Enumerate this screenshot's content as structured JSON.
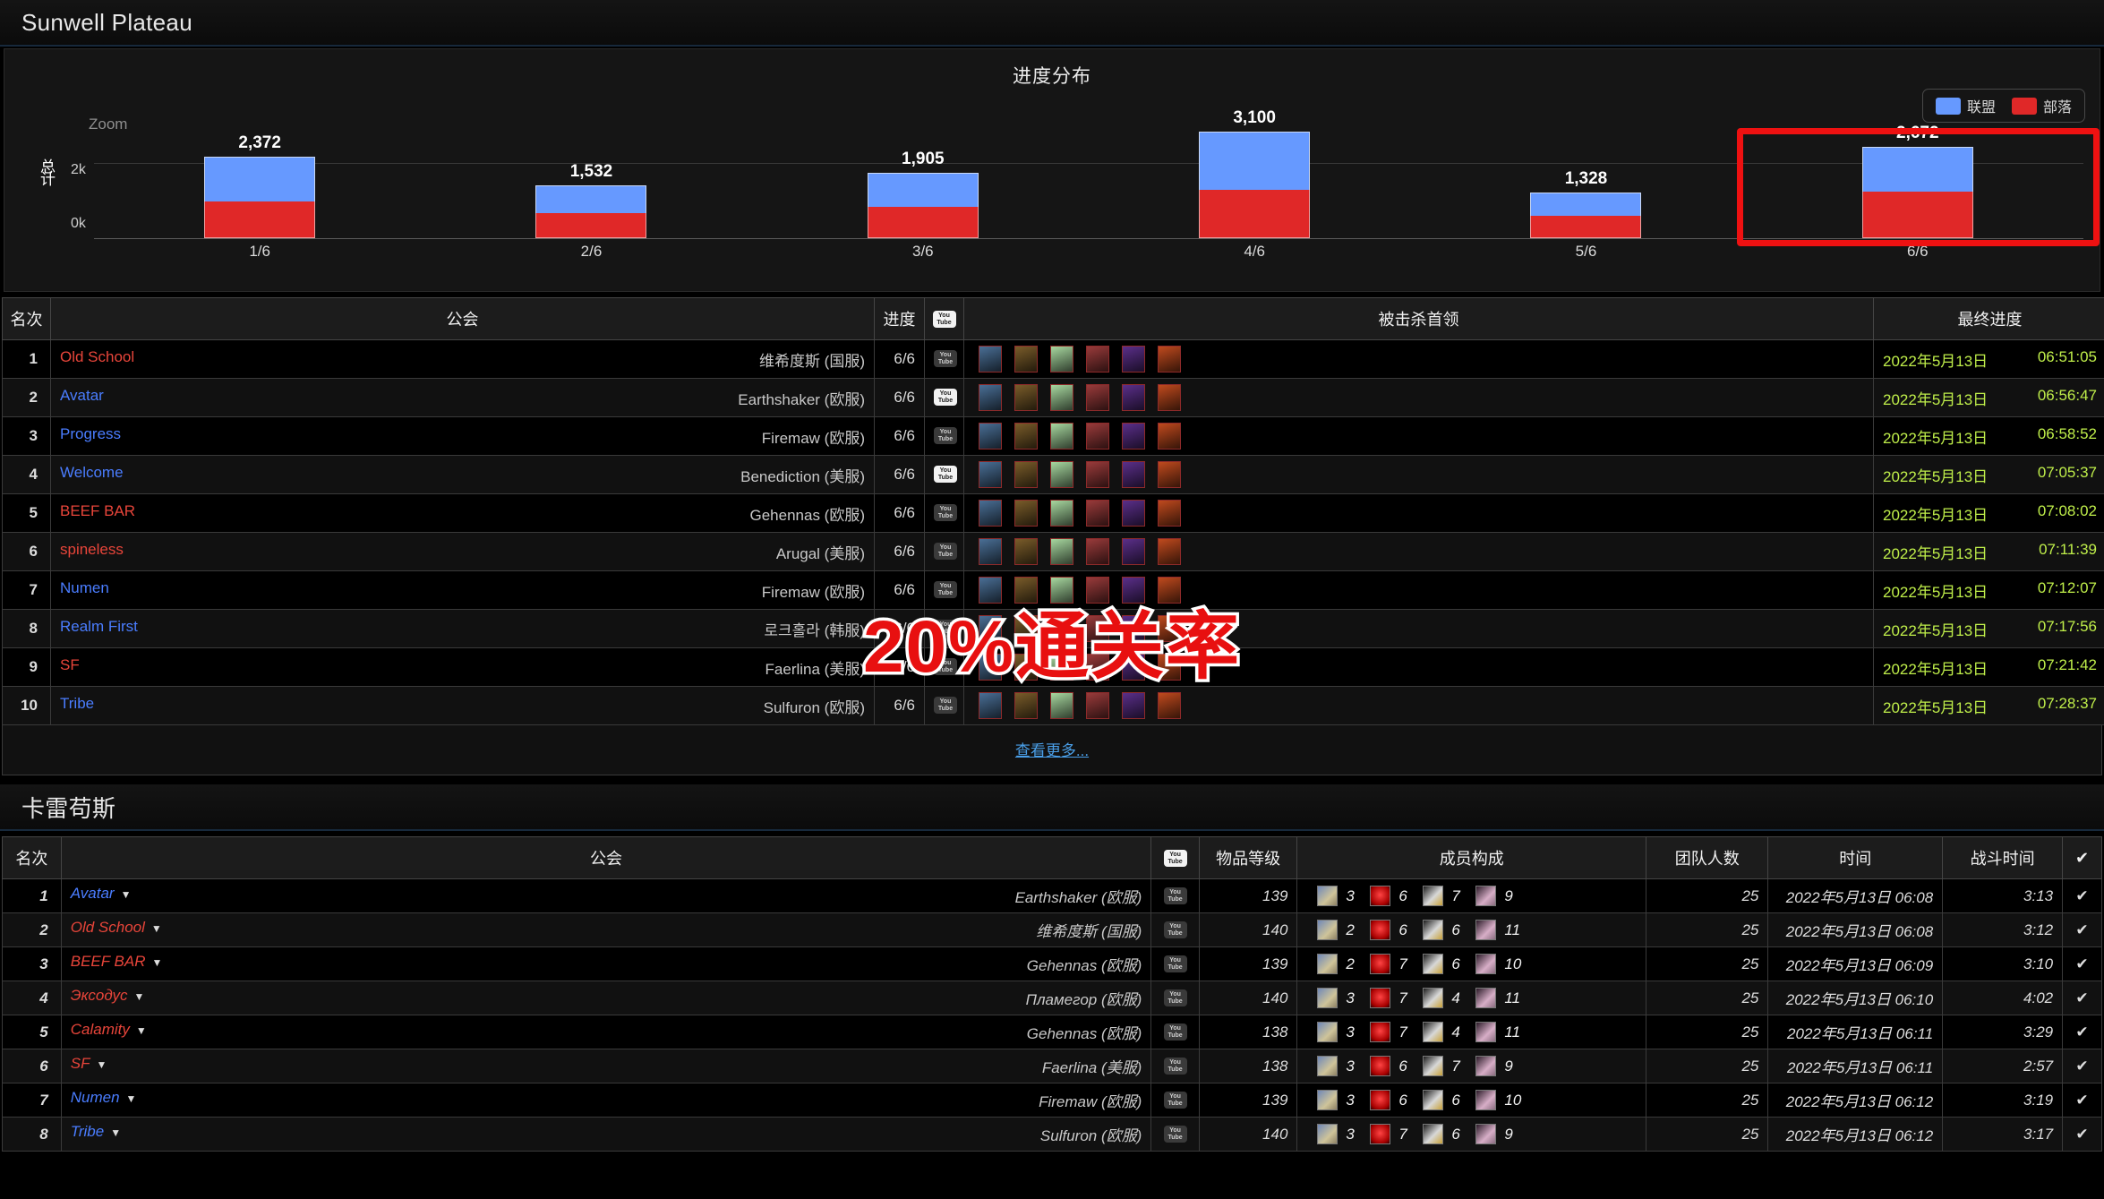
{
  "section1": {
    "title": "Sunwell Plateau",
    "chart": {
      "title": "进度分布",
      "zoom_label": "Zoom",
      "y_axis_label": "总计",
      "legend": [
        {
          "name": "联盟",
          "color": "#6699ff"
        },
        {
          "name": "部落",
          "color": "#e02828"
        }
      ],
      "y_ticks": [
        "2k",
        "0k"
      ]
    },
    "table": {
      "headers": {
        "rank": "名次",
        "guild": "公会",
        "progress": "进度",
        "youtube": "YouTube",
        "bosses": "被击杀首领",
        "final": "最终进度"
      },
      "rows": [
        {
          "rank": "1",
          "guild": "Old School",
          "guild_color": "#e8453a",
          "realm": "维希度斯 (国服)",
          "progress": "6/6",
          "yt_on": false,
          "bosses": 6,
          "date": "2022年5月13日",
          "time": "06:51:05"
        },
        {
          "rank": "2",
          "guild": "Avatar",
          "guild_color": "#4a7dff",
          "realm": "Earthshaker (欧服)",
          "progress": "6/6",
          "yt_on": true,
          "bosses": 6,
          "date": "2022年5月13日",
          "time": "06:56:47"
        },
        {
          "rank": "3",
          "guild": "Progress",
          "guild_color": "#4a7dff",
          "realm": "Firemaw (欧服)",
          "progress": "6/6",
          "yt_on": false,
          "bosses": 6,
          "date": "2022年5月13日",
          "time": "06:58:52"
        },
        {
          "rank": "4",
          "guild": "Welcome",
          "guild_color": "#4a7dff",
          "realm": "Benediction (美服)",
          "progress": "6/6",
          "yt_on": true,
          "bosses": 6,
          "date": "2022年5月13日",
          "time": "07:05:37"
        },
        {
          "rank": "5",
          "guild": "BEEF BAR",
          "guild_color": "#e8453a",
          "realm": "Gehennas (欧服)",
          "progress": "6/6",
          "yt_on": false,
          "bosses": 6,
          "date": "2022年5月13日",
          "time": "07:08:02"
        },
        {
          "rank": "6",
          "guild": "spineless",
          "guild_color": "#e8453a",
          "realm": "Arugal (美服)",
          "progress": "6/6",
          "yt_on": false,
          "bosses": 6,
          "date": "2022年5月13日",
          "time": "07:11:39"
        },
        {
          "rank": "7",
          "guild": "Numen",
          "guild_color": "#4a7dff",
          "realm": "Firemaw (欧服)",
          "progress": "6/6",
          "yt_on": false,
          "bosses": 6,
          "date": "2022年5月13日",
          "time": "07:12:07"
        },
        {
          "rank": "8",
          "guild": "Realm First",
          "guild_color": "#4a7dff",
          "realm": "로크홀라 (韩服)",
          "progress": "6/6",
          "yt_on": false,
          "bosses": 6,
          "date": "2022年5月13日",
          "time": "07:17:56"
        },
        {
          "rank": "9",
          "guild": "SF",
          "guild_color": "#e8453a",
          "realm": "Faerlina (美服)",
          "progress": "6/6",
          "yt_on": false,
          "bosses": 6,
          "date": "2022年5月13日",
          "time": "07:21:42"
        },
        {
          "rank": "10",
          "guild": "Tribe",
          "guild_color": "#4a7dff",
          "realm": "Sulfuron (欧服)",
          "progress": "6/6",
          "yt_on": false,
          "bosses": 6,
          "date": "2022年5月13日",
          "time": "07:28:37"
        }
      ],
      "more_link": "查看更多..."
    }
  },
  "section2": {
    "title": "卡雷苟斯",
    "table": {
      "headers": {
        "rank": "名次",
        "guild": "公会",
        "youtube": "YouTube",
        "ilvl": "物品等级",
        "comp": "成员构成",
        "raid_size": "团队人数",
        "time": "时间",
        "fight_time": "战斗时间",
        "check": "✔"
      },
      "rows": [
        {
          "rank": "1",
          "guild": "Avatar",
          "guild_color": "#4a7dff",
          "realm": "Earthshaker (欧服)",
          "ilvl": "139",
          "tank": "3",
          "heal": "6",
          "melee": "7",
          "ranged": "9",
          "raid_size": "25",
          "time": "2022年5月13日 06:08",
          "fight": "3:13"
        },
        {
          "rank": "2",
          "guild": "Old School",
          "guild_color": "#e8453a",
          "realm": "维希度斯 (国服)",
          "ilvl": "140",
          "tank": "2",
          "heal": "6",
          "melee": "6",
          "ranged": "11",
          "raid_size": "25",
          "time": "2022年5月13日 06:08",
          "fight": "3:12"
        },
        {
          "rank": "3",
          "guild": "BEEF BAR",
          "guild_color": "#e8453a",
          "realm": "Gehennas (欧服)",
          "ilvl": "139",
          "tank": "2",
          "heal": "7",
          "melee": "6",
          "ranged": "10",
          "raid_size": "25",
          "time": "2022年5月13日 06:09",
          "fight": "3:10"
        },
        {
          "rank": "4",
          "guild": "Эксодус",
          "guild_color": "#e8453a",
          "realm": "Пламегор (欧服)",
          "ilvl": "140",
          "tank": "3",
          "heal": "7",
          "melee": "4",
          "ranged": "11",
          "raid_size": "25",
          "time": "2022年5月13日 06:10",
          "fight": "4:02"
        },
        {
          "rank": "5",
          "guild": "Calamity",
          "guild_color": "#e8453a",
          "realm": "Gehennas (欧服)",
          "ilvl": "138",
          "tank": "3",
          "heal": "7",
          "melee": "4",
          "ranged": "11",
          "raid_size": "25",
          "time": "2022年5月13日 06:11",
          "fight": "3:29"
        },
        {
          "rank": "6",
          "guild": "SF",
          "guild_color": "#e8453a",
          "realm": "Faerlina (美服)",
          "ilvl": "138",
          "tank": "3",
          "heal": "6",
          "melee": "7",
          "ranged": "9",
          "raid_size": "25",
          "time": "2022年5月13日 06:11",
          "fight": "2:57"
        },
        {
          "rank": "7",
          "guild": "Numen",
          "guild_color": "#4a7dff",
          "realm": "Firemaw (欧服)",
          "ilvl": "139",
          "tank": "3",
          "heal": "6",
          "melee": "6",
          "ranged": "10",
          "raid_size": "25",
          "time": "2022年5月13日 06:12",
          "fight": "3:19"
        },
        {
          "rank": "8",
          "guild": "Tribe",
          "guild_color": "#4a7dff",
          "realm": "Sulfuron (欧服)",
          "ilvl": "140",
          "tank": "3",
          "heal": "7",
          "melee": "6",
          "ranged": "9",
          "raid_size": "25",
          "time": "2022年5月13日 06:12",
          "fight": "3:17"
        }
      ]
    }
  },
  "overlay": {
    "text": "20%通关率",
    "fill_color": "#e81010",
    "stroke_color": "#ffffff"
  },
  "annotation": {
    "box_color": "#ee1111",
    "target_category": "6/6"
  },
  "boss_colors": [
    "#4a6f96",
    "#7a5c2a",
    "#a8d8a0",
    "#9a3b3b",
    "#5b2f8a",
    "#c04a1e"
  ],
  "chart_data": {
    "type": "bar",
    "title": "进度分布",
    "xlabel": "",
    "ylabel": "总计",
    "categories": [
      "1/6",
      "2/6",
      "3/6",
      "4/6",
      "5/6",
      "6/6"
    ],
    "values": [
      2372,
      1532,
      1905,
      3100,
      1328,
      2672
    ],
    "series": [
      {
        "name": "联盟",
        "color": "#6699ff",
        "values": [
          1290,
          800,
          980,
          1700,
          680,
          1320
        ]
      },
      {
        "name": "部落",
        "color": "#e02828",
        "values": [
          1082,
          732,
          925,
          1400,
          648,
          1352
        ]
      }
    ],
    "stacked": true,
    "ylim": [
      0,
      3100
    ],
    "yticks": [
      0,
      2000
    ],
    "ytick_labels": [
      "0k",
      "2k"
    ],
    "grid": true,
    "legend_position": "top-right",
    "data_labels": [
      "2,372",
      "1,532",
      "1,905",
      "3,100",
      "1,328",
      "2,672"
    ]
  }
}
